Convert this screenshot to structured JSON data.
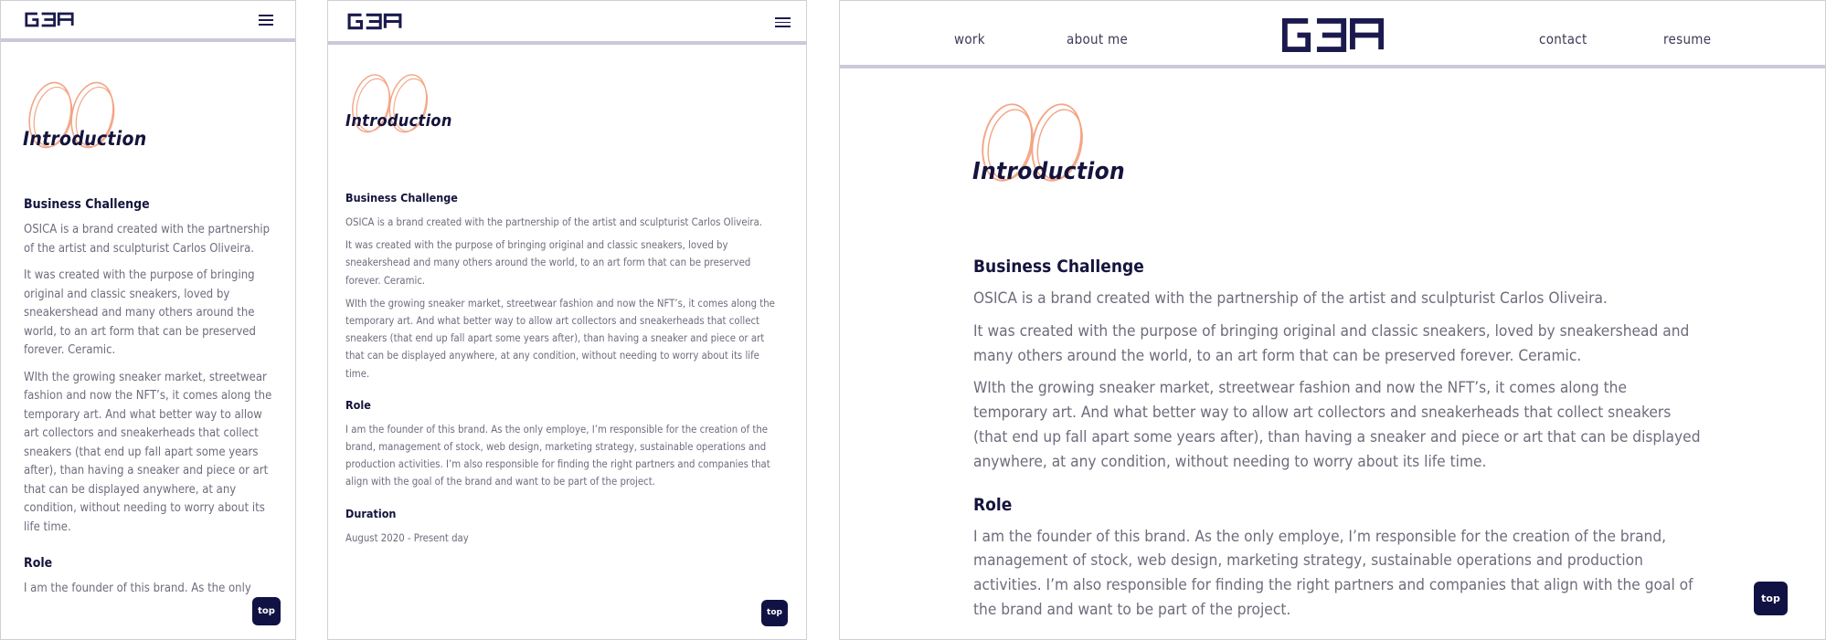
{
  "brand": {
    "logo_text": "GEA"
  },
  "nav": {
    "work": "work",
    "about": "about me",
    "contact": "contact",
    "resume": "resume"
  },
  "intro": {
    "title": "Introduction"
  },
  "sections": {
    "challenge_heading": "Business Challenge",
    "challenge_p1": "OSICA is a brand created with the partnership of the artist and sculpturist Carlos Oliveira.",
    "challenge_p2": "It was created with the purpose of bringing original and classic sneakers, loved by sneakershead and many others around the world, to an art form that can be preserved forever. Ceramic.",
    "challenge_p3": "WIth the growing sneaker market, streetwear fashion and now the NFT’s, it comes along the temporary art. And what better way to allow art collectors and sneakerheads that collect sneakers (that end up fall apart some years after), than having a sneaker and piece or art that can be displayed anywhere, at any condition, without needing to worry about its life time.",
    "role_heading": "Role",
    "role_p": "I am the founder of this brand. As the only employe, I’m responsible for the creation of the brand, management of stock, web design, marketing strategy, sustainable operations and production activities. I’m also responsible for finding the right partners and companies that align with the goal of the brand and want to be part of the project.",
    "role_p_cut": "I am the founder of this brand. As the only",
    "duration_heading": "Duration",
    "duration_value": "August 2020 - Present day"
  },
  "buttons": {
    "top": "top"
  },
  "colors": {
    "navy": "#14143d",
    "accent_outline": "#f3a585",
    "bar": "#c9c9da",
    "text": "#6f6c7c"
  },
  "icons": {
    "menu": "hamburger-icon"
  }
}
